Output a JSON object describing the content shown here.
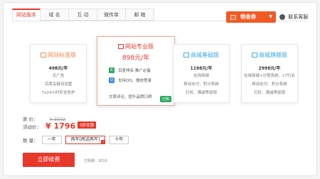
{
  "tabs": [
    "网站版本",
    "域 名",
    "互 动",
    "微传单",
    "邮 箱"
  ],
  "coupon": {
    "label": "领金券",
    "caret": "▼"
  },
  "service": {
    "label": "联系客服"
  },
  "plans": [
    {
      "title": "网站标准版",
      "price": "498元/年",
      "features": [
        "无广告",
        "百度关键词设置",
        "7x24小时安全防护"
      ]
    },
    {
      "title": "网站专业版",
      "price": "898元/年",
      "features": [
        "百度排名-推广必备",
        "支持QQ、微信登录",
        "文章评论，提升品牌口碑"
      ],
      "badge": "已购"
    },
    {
      "title": "商城基础版",
      "price": "1198元/年",
      "features": [
        "在线商城",
        "移动支付、积分系统",
        "打折、满减等促销"
      ]
    },
    {
      "title": "商城旗舰版",
      "price": "2998元/年",
      "features": [
        "在线商城+分销系统、17行业",
        "移动支付、积分系统",
        "打折、满减等促销"
      ]
    }
  ],
  "pricing": {
    "orig_label": "原 价：",
    "orig_value": "¥ 3592",
    "sale_label": "活动价：",
    "sale_value": "¥ 1796",
    "sale_tag": "5折优惠",
    "qty_label": "数 量：",
    "qty_options": [
      "一年",
      "两年[两送两年]",
      "十年"
    ],
    "qty_selected": "两年[两送两年]"
  },
  "renew_button": "立即续费",
  "sold_count": "已购量：2016",
  "colors": {
    "accent": "#e8382b",
    "coupon": "#f15a24",
    "orange_title": "#f08a4b",
    "blue_title": "#3aa6e6",
    "badge_green": "#2fa862"
  }
}
